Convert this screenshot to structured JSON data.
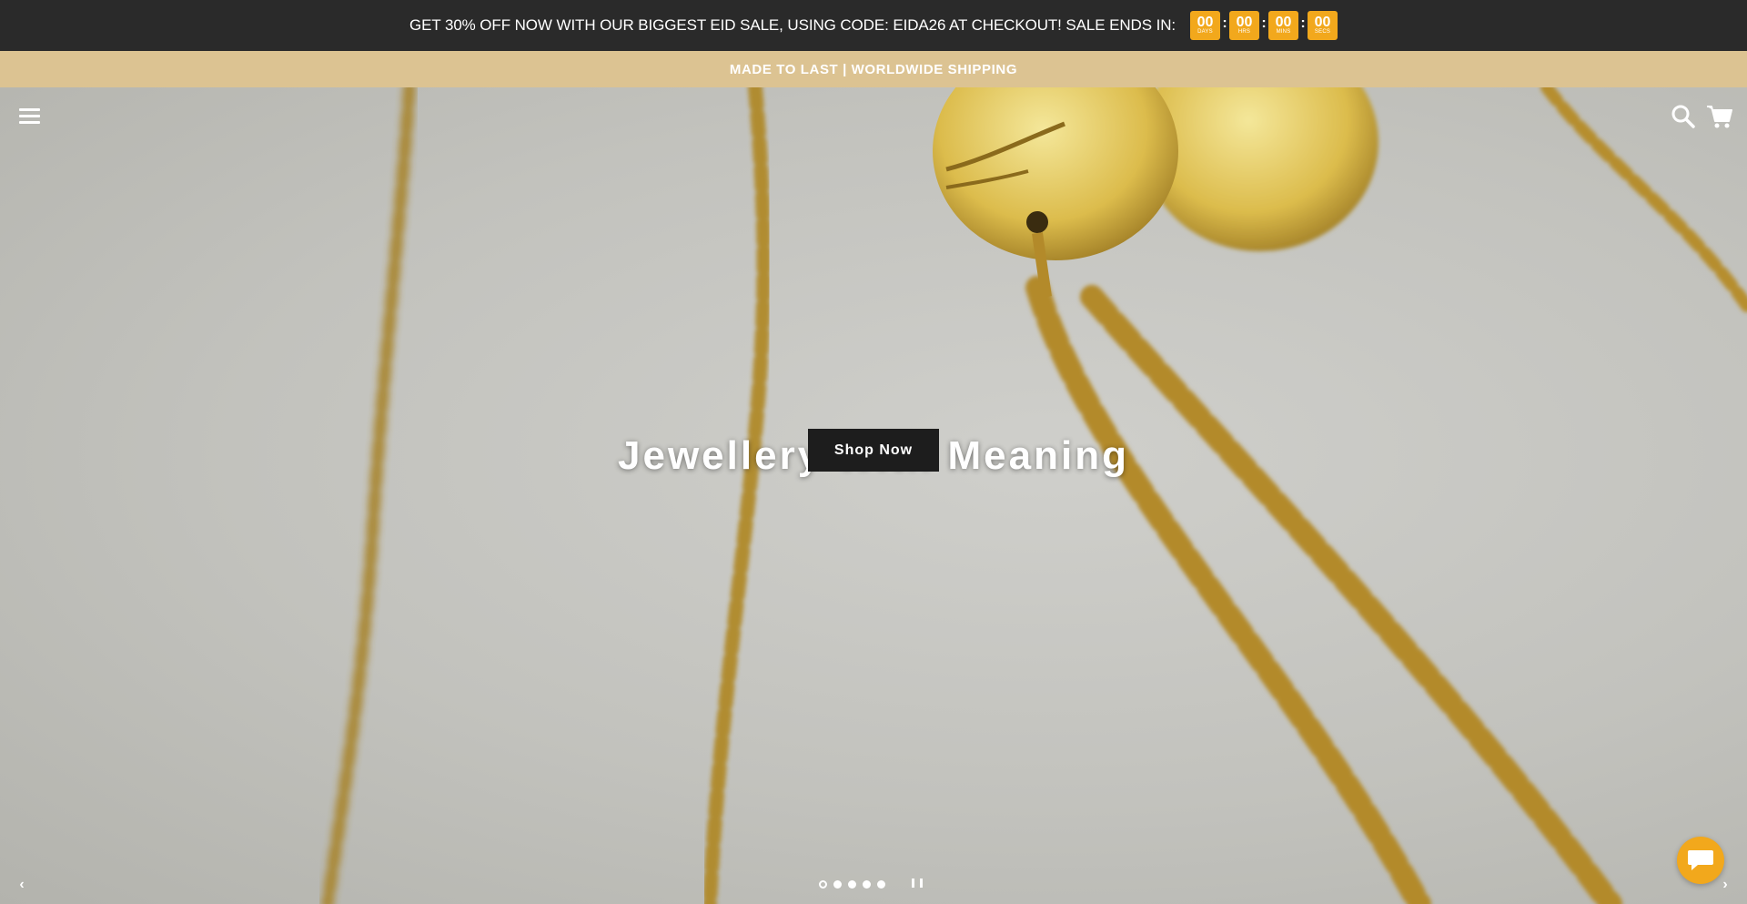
{
  "promo": {
    "text": "GET 30% OFF NOW WITH OUR BIGGEST EID SALE, USING CODE: EIDA26 AT CHECKOUT! SALE ENDS IN:",
    "countdown": [
      {
        "value": "00",
        "label": "DAYS"
      },
      {
        "value": "00",
        "label": "HRS"
      },
      {
        "value": "00",
        "label": "MINS"
      },
      {
        "value": "00",
        "label": "SECS"
      }
    ],
    "separator": ":",
    "accent_color": "#f2a81c",
    "background_color": "#2a2a2a"
  },
  "announcement": {
    "text": "MADE TO LAST | WORLDWIDE SHIPPING",
    "background_color": "#dcc392"
  },
  "header": {
    "menu_icon": "hamburger-menu-icon",
    "search_icon": "search-icon",
    "cart_icon": "cart-icon"
  },
  "hero": {
    "title": "Jewellery With Meaning",
    "button_label": "Shop Now",
    "prev_arrow": "‹",
    "next_arrow": "›",
    "slide_count": 5,
    "active_slide": 1
  },
  "chat": {
    "icon": "chat-bubble-icon"
  }
}
